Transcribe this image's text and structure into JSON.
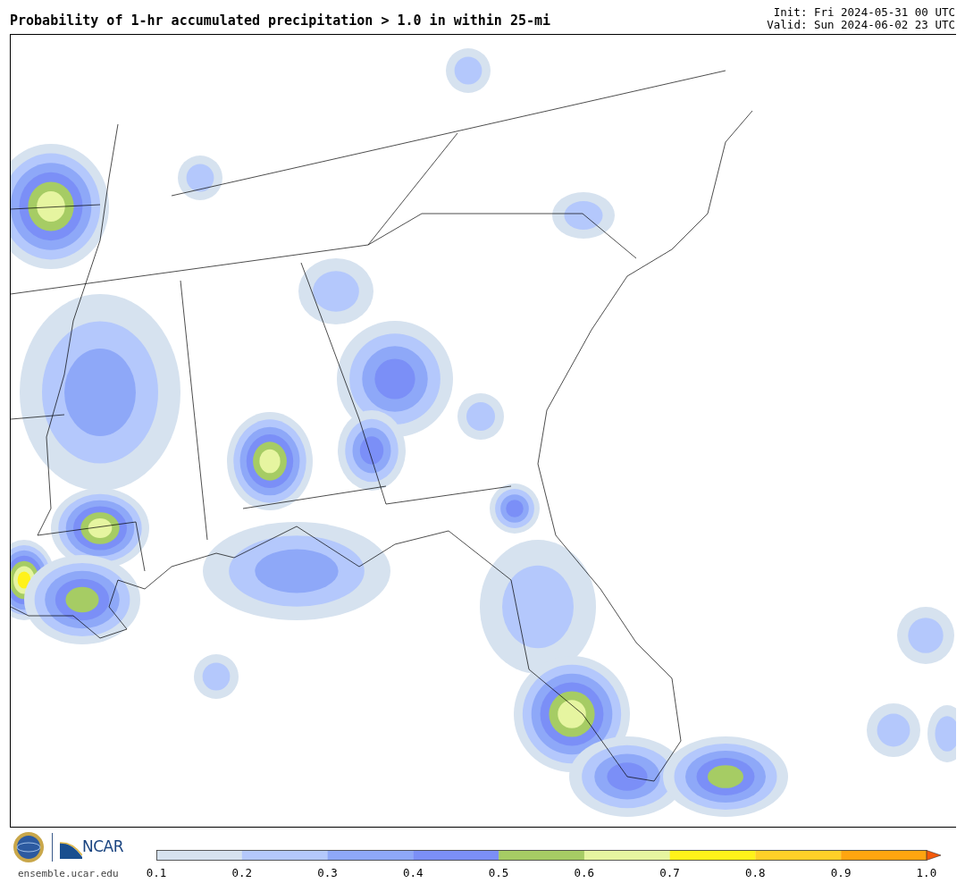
{
  "title": "Probability of 1-hr accumulated precipitation > 1.0 in within 25-mi",
  "run_info": [
    "Init: Fri 2024-05-31 00 UTC",
    "Valid: Sun 2024-06-02 23 UTC"
  ],
  "footer": {
    "logo_text": "NCAR",
    "site": "ensemble.ucar.edu"
  },
  "colorbar": {
    "bins": [
      {
        "kind": "band",
        "color": "#d6e2ef"
      },
      {
        "kind": "band",
        "color": "#b4c8fc"
      },
      {
        "kind": "band",
        "color": "#8ea8f8"
      },
      {
        "kind": "band",
        "color": "#7b8ff7"
      },
      {
        "kind": "band",
        "color": "#a6cc64"
      },
      {
        "kind": "band",
        "color": "#e6f5a0"
      },
      {
        "kind": "band",
        "color": "#fff21a"
      },
      {
        "kind": "band",
        "color": "#ffd028"
      },
      {
        "kind": "band",
        "color": "#ffa510"
      },
      {
        "kind": "arrow",
        "color": "#f55a0a"
      }
    ],
    "ticks": [
      "0.1",
      "0.2",
      "0.3",
      "0.4",
      "0.5",
      "0.6",
      "0.7",
      "0.8",
      "0.9",
      "1.0"
    ]
  }
}
